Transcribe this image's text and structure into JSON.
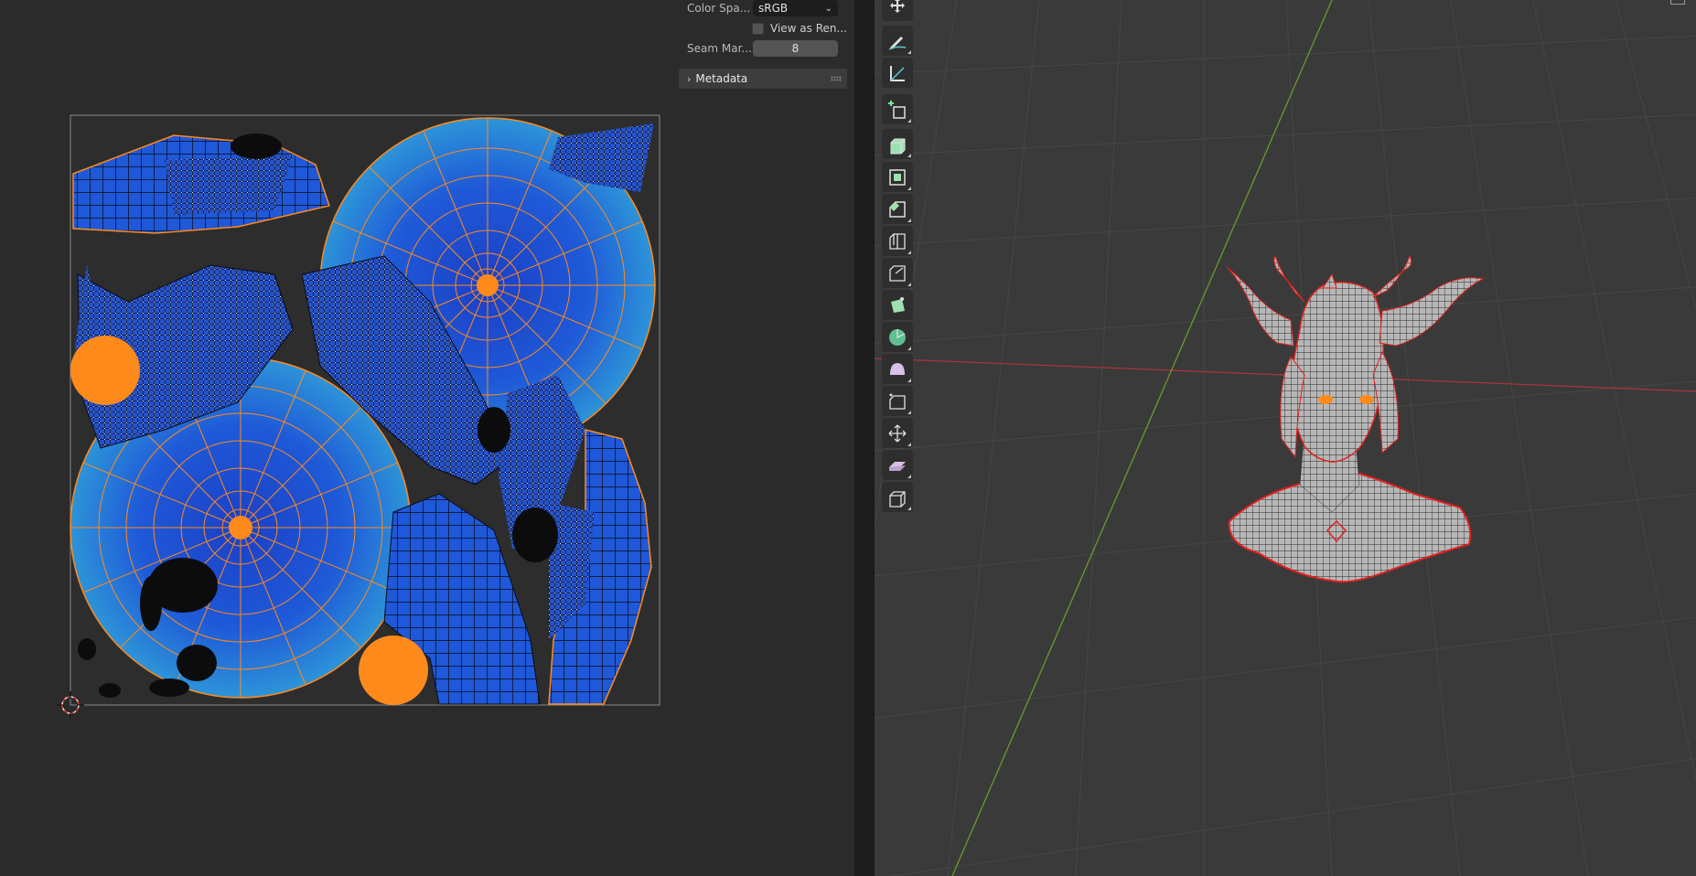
{
  "uv_sidebar": {
    "color_space": {
      "label": "Color Spa...",
      "value": "sRGB"
    },
    "view_as_render": {
      "label": "View as Ren...",
      "checked": false
    },
    "seam_margin": {
      "label": "Seam Mar...",
      "value": "8"
    },
    "metadata": {
      "label": "Metadata",
      "expanded": false
    }
  },
  "toolbar": {
    "tools": [
      {
        "name": "transform-icon",
        "active": false
      },
      {
        "name": "annotate-icon",
        "active": false
      },
      {
        "name": "measure-icon",
        "active": false
      },
      {
        "name": "add-cube-icon",
        "active": false
      },
      {
        "name": "extrude-region-icon",
        "active": false
      },
      {
        "name": "inset-faces-icon",
        "active": false
      },
      {
        "name": "bevel-icon",
        "active": false
      },
      {
        "name": "loop-cut-icon",
        "active": false
      },
      {
        "name": "knife-icon",
        "active": false
      },
      {
        "name": "poly-build-icon",
        "active": false
      },
      {
        "name": "spin-icon",
        "active": false
      },
      {
        "name": "smooth-icon",
        "active": false
      },
      {
        "name": "edge-slide-icon",
        "active": false
      },
      {
        "name": "shrink-fatten-icon",
        "active": false
      },
      {
        "name": "shear-icon",
        "active": false
      },
      {
        "name": "rip-region-icon",
        "active": false
      }
    ]
  },
  "colors": {
    "uv_face": "#1f58d8",
    "uv_face_light": "#2b8fd6",
    "uv_edge_selected": "#ff8a1c",
    "seam": "#e0201e",
    "x_axis": "#a8343c",
    "y_axis": "#6a9a2a",
    "grid": "#454545",
    "viewport_bg": "#3a3a3a",
    "editor_bg": "#2b2b2b"
  }
}
